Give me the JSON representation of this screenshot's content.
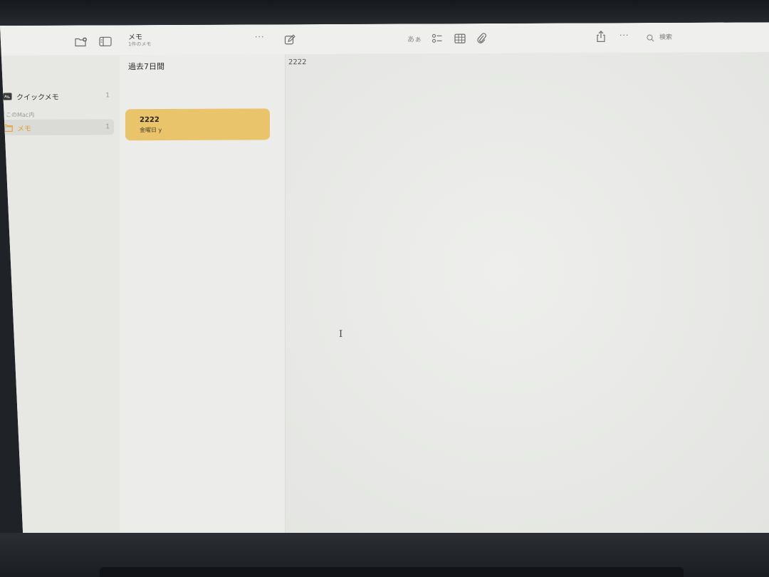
{
  "toolbar": {
    "list_title": "メモ",
    "list_subtitle": "1件のメモ",
    "more_glyph": "···",
    "format_label": "あぁ",
    "more_glyph_right": "···",
    "search_placeholder": "検索"
  },
  "sidebar": {
    "quick_notes_label": "クイックメモ",
    "quick_notes_count": "1",
    "section_title": "このMac内",
    "folder_label": "メモ",
    "folder_count": "1"
  },
  "note_list": {
    "section_header": "過去7日間",
    "notes": [
      {
        "title": "2222",
        "subtitle": "金曜日 y"
      }
    ]
  },
  "editor": {
    "body": "2222",
    "cursor_glyph": "I"
  },
  "colors": {
    "accent": "#e0a02a",
    "selected_note": "#e9c46a"
  }
}
